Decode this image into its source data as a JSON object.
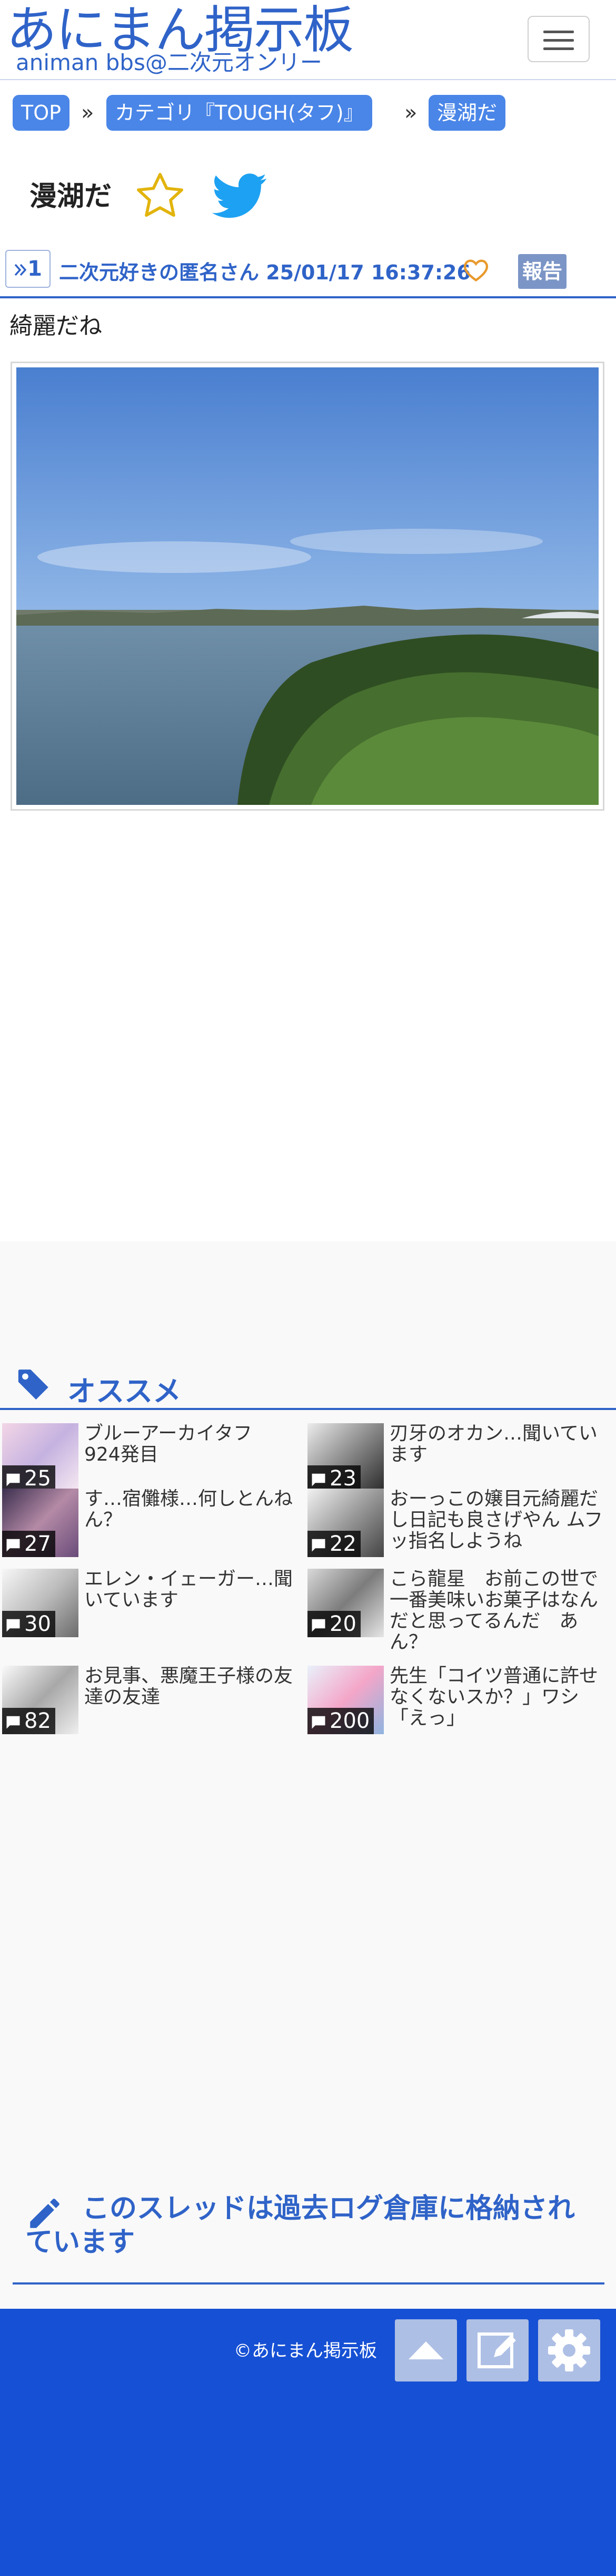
{
  "header": {
    "logo_title": "あにまん掲示板",
    "logo_subtitle": "animan bbs@二次元オンリー"
  },
  "breadcrumb": {
    "top": "TOP",
    "category": "カテゴリ『TOUGH(タフ)』",
    "thread": "漫湖だ",
    "separator": "»"
  },
  "thread": {
    "title": "漫湖だ"
  },
  "post": {
    "number": "1",
    "author_datetime": "二次元好きの匿名さん 25/01/17 16:37:26",
    "report_label": "報告",
    "body": "綺麗だね"
  },
  "recommend": {
    "title": "オススメ",
    "items": [
      {
        "title": "ブルーアーカイタフ　924発目",
        "count": "25"
      },
      {
        "title": "刃牙のオカン…聞いています",
        "count": "23"
      },
      {
        "title": "す…宿儺様…何しとんねん？",
        "count": "27"
      },
      {
        "title": "おーっこの嬢目元綺麗だし日記も良さげやん ムフッ指名しようね",
        "count": "22"
      },
      {
        "title": "エレン・イェーガー…聞いています",
        "count": "30"
      },
      {
        "title": "こら龍星　お前この世で一番美味いお菓子はなんだと思ってるんだ　あん？",
        "count": "20"
      },
      {
        "title": "お見事、悪魔王子様の友達の友達",
        "count": "82"
      },
      {
        "title": "先生「コイツ普通に許せなくないスか？」ワシ「えっ」",
        "count": "200"
      }
    ]
  },
  "archive": {
    "message": "このスレッドは過去ログ倉庫に格納されています"
  },
  "footer": {
    "copyright": "©あにまん掲示板"
  },
  "colors": {
    "brand": "#2f63c8",
    "breadcrumb": "#4a86e8",
    "footer": "#1650d4",
    "footer_button": "#aebfe5",
    "report": "#7b95c6"
  },
  "icons": [
    "hamburger-menu-icon",
    "star-icon",
    "twitter-icon",
    "double-chevron-right-icon",
    "heart-icon",
    "tag-icon",
    "comment-icon",
    "pencil-icon",
    "arrow-up-icon",
    "edit-icon",
    "gear-icon"
  ]
}
